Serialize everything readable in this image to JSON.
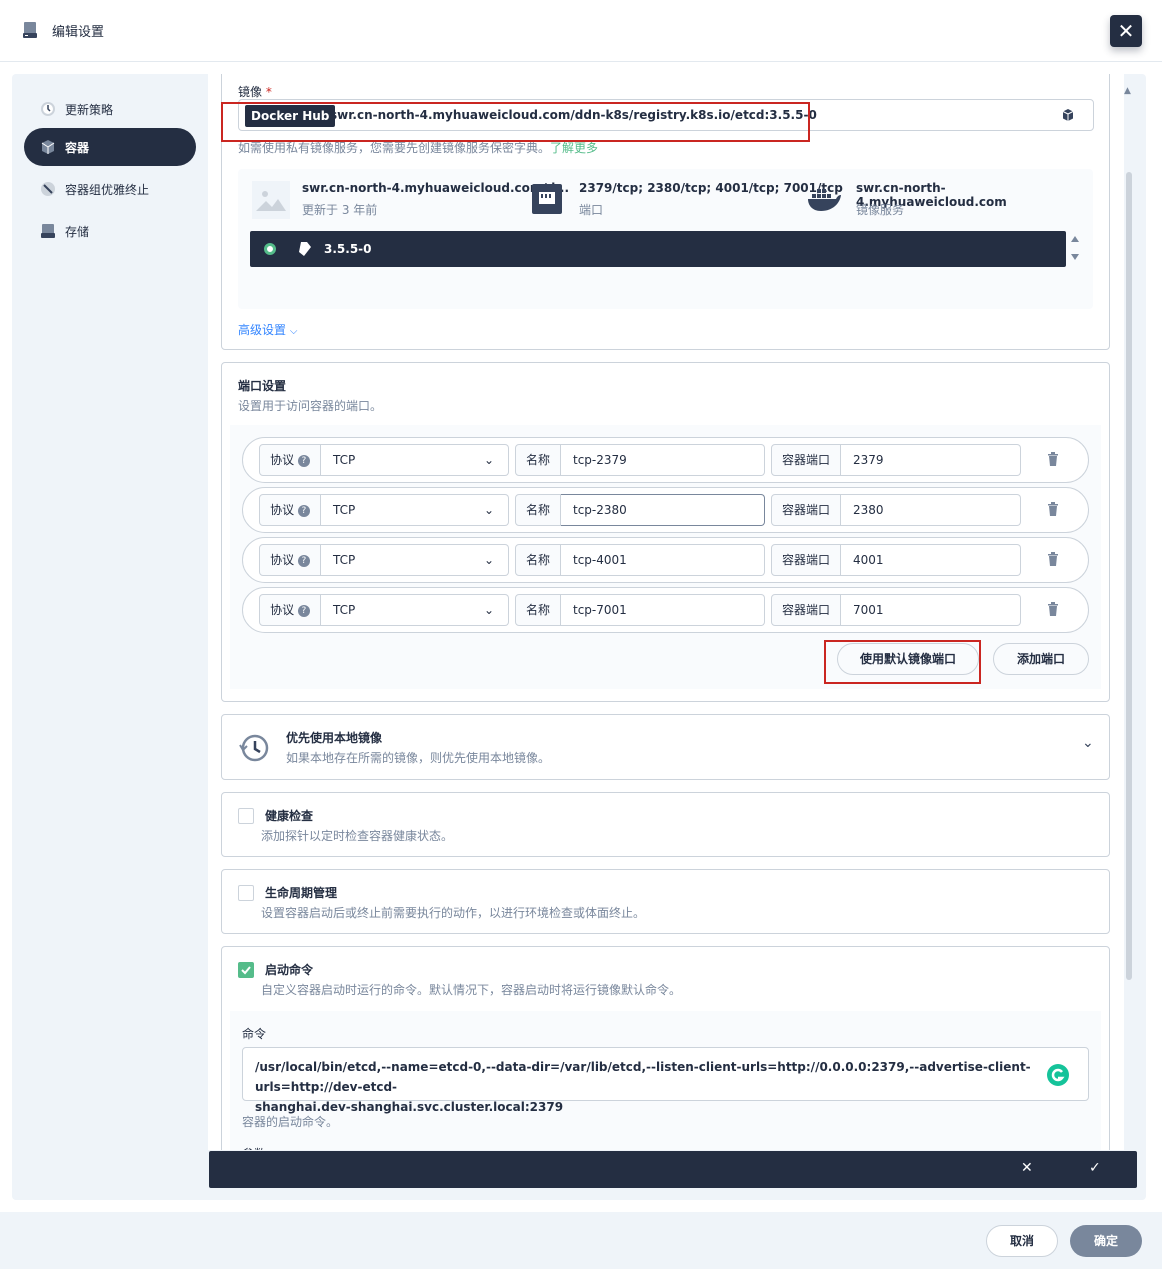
{
  "header": {
    "title": "编辑设置",
    "close": "✕"
  },
  "sidebar": {
    "items": [
      {
        "label": "更新策略",
        "icon": "update-strategy-icon"
      },
      {
        "label": "容器",
        "icon": "container-icon",
        "active": true
      },
      {
        "label": "容器组优雅终止",
        "icon": "terminate-icon"
      },
      {
        "label": "存储",
        "icon": "storage-icon"
      }
    ]
  },
  "image": {
    "label": "镜像",
    "required": "*",
    "registry_badge": "Docker Hub",
    "value": "swr.cn-north-4.myhuaweicloud.com/ddn-k8s/registry.k8s.io/etcd:3.5.5-0",
    "hint": "如需使用私有镜像服务，您需要先创建镜像服务保密字典。",
    "hint_link": "了解更多",
    "info": {
      "name": "swr.cn-north-4.myhuaweicloud.com/d...",
      "updated": "更新于 3 年前",
      "ports": "2379/tcp; 2380/tcp; 4001/tcp; 7001/tcp",
      "ports_label": "端口",
      "registry": "swr.cn-north-4.myhuaweicloud.com",
      "registry_label": "镜像服务"
    },
    "tag": "3.5.5-0",
    "advanced": "高级设置"
  },
  "ports": {
    "title": "端口设置",
    "desc": "设置用于访问容器的端口。",
    "protocol_label": "协议",
    "name_label": "名称",
    "container_port_label": "容器端口",
    "rows": [
      {
        "protocol": "TCP",
        "name": "tcp-2379",
        "port": "2379"
      },
      {
        "protocol": "TCP",
        "name": "tcp-2380",
        "port": "2380"
      },
      {
        "protocol": "TCP",
        "name": "tcp-4001",
        "port": "4001"
      },
      {
        "protocol": "TCP",
        "name": "tcp-7001",
        "port": "7001"
      }
    ],
    "use_default": "使用默认镜像端口",
    "add": "添加端口"
  },
  "local_image": {
    "title": "优先使用本地镜像",
    "desc": "如果本地存在所需的镜像，则优先使用本地镜像。"
  },
  "health": {
    "title": "健康检查",
    "desc": "添加探针以定时检查容器健康状态。"
  },
  "lifecycle": {
    "title": "生命周期管理",
    "desc": "设置容器启动后或终止前需要执行的动作，以进行环境检查或体面终止。"
  },
  "startup": {
    "title": "启动命令",
    "desc": "自定义容器启动时运行的命令。默认情况下，容器启动时将运行镜像默认命令。",
    "command_label": "命令",
    "command_line1": "/usr/local/bin/etcd,--name=etcd-0,--data-dir=/var/lib/etcd,--listen-client-urls=http://0.0.0.0:2379,--advertise-client-urls=http://dev-etcd-",
    "command_line2": "shanghai.dev-shanghai.svc.cluster.local:2379",
    "command_hint": "容器的启动命令。",
    "args_label": "参数"
  },
  "darkbar": {
    "cancel": "✕",
    "ok": "✓"
  },
  "footer": {
    "cancel": "取消",
    "ok": "确定"
  },
  "colors": {
    "dark": "#242e42",
    "accent": "#55bc8a",
    "red": "#ca2621",
    "bg": "#eff4f9"
  }
}
